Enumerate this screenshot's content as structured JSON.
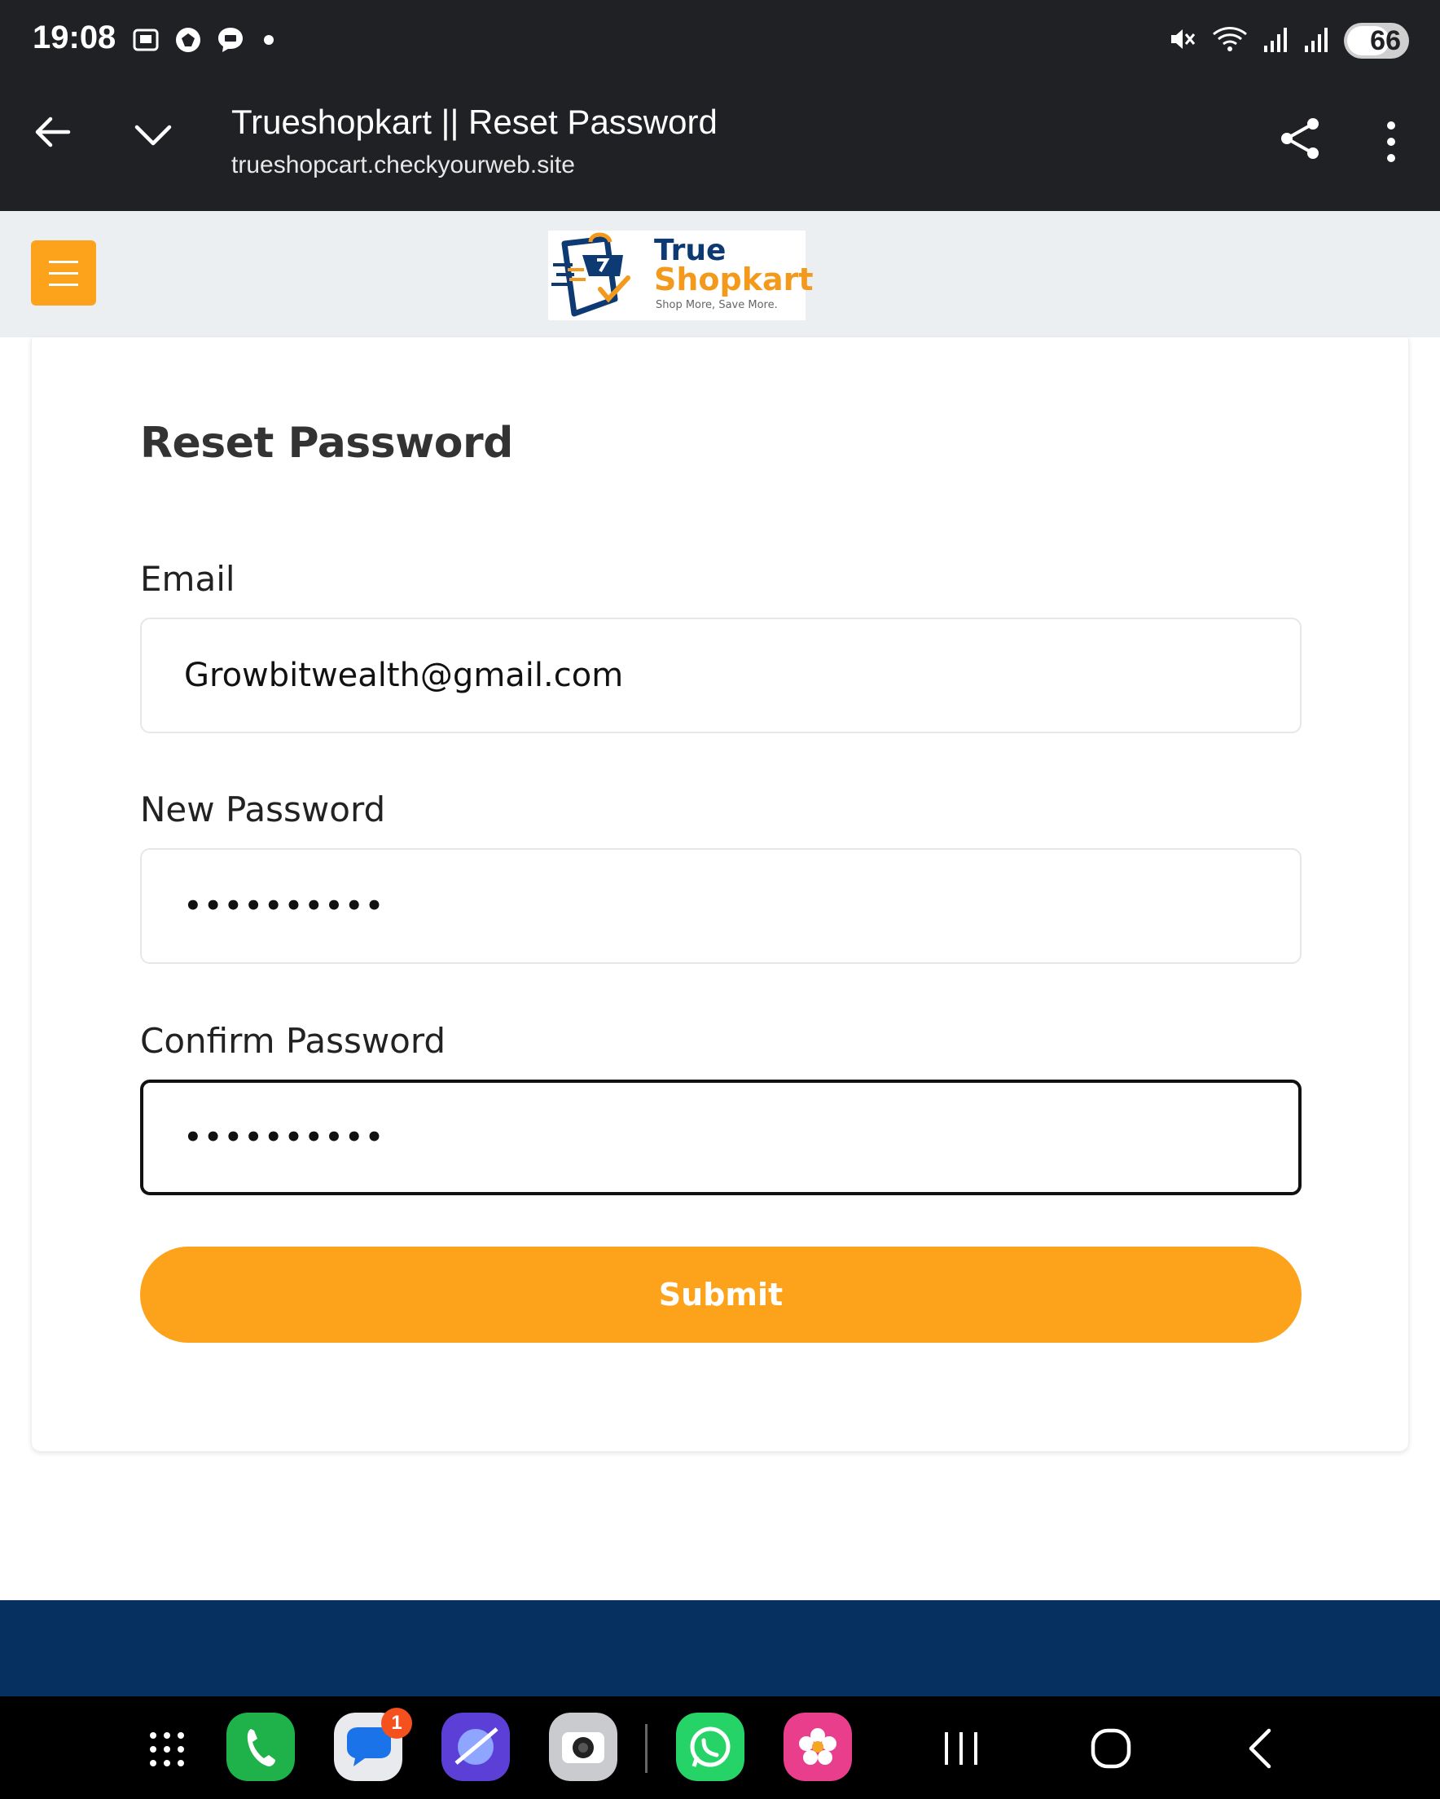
{
  "status_bar": {
    "time": "19:08",
    "battery": "66"
  },
  "browser": {
    "page_title": "Trueshopkart || Reset Password",
    "url": "trueshopcart.checkyourweb.site"
  },
  "site_header": {
    "logo": {
      "word1": "True",
      "word2": "Shopkart",
      "tagline": "Shop More, Save More."
    }
  },
  "form": {
    "title": "Reset Password",
    "email_label": "Email",
    "email_value": "Growbitwealth@gmail.com",
    "new_password_label": "New Password",
    "new_password_value": "••••••••••",
    "confirm_password_label": "Confirm Password",
    "confirm_password_value": "••••••••••",
    "submit_label": "Submit"
  },
  "nav_bar": {
    "messages_badge": "1"
  },
  "colors": {
    "accent": "#fda31b",
    "footer": "#063060",
    "chrome": "#202124"
  }
}
